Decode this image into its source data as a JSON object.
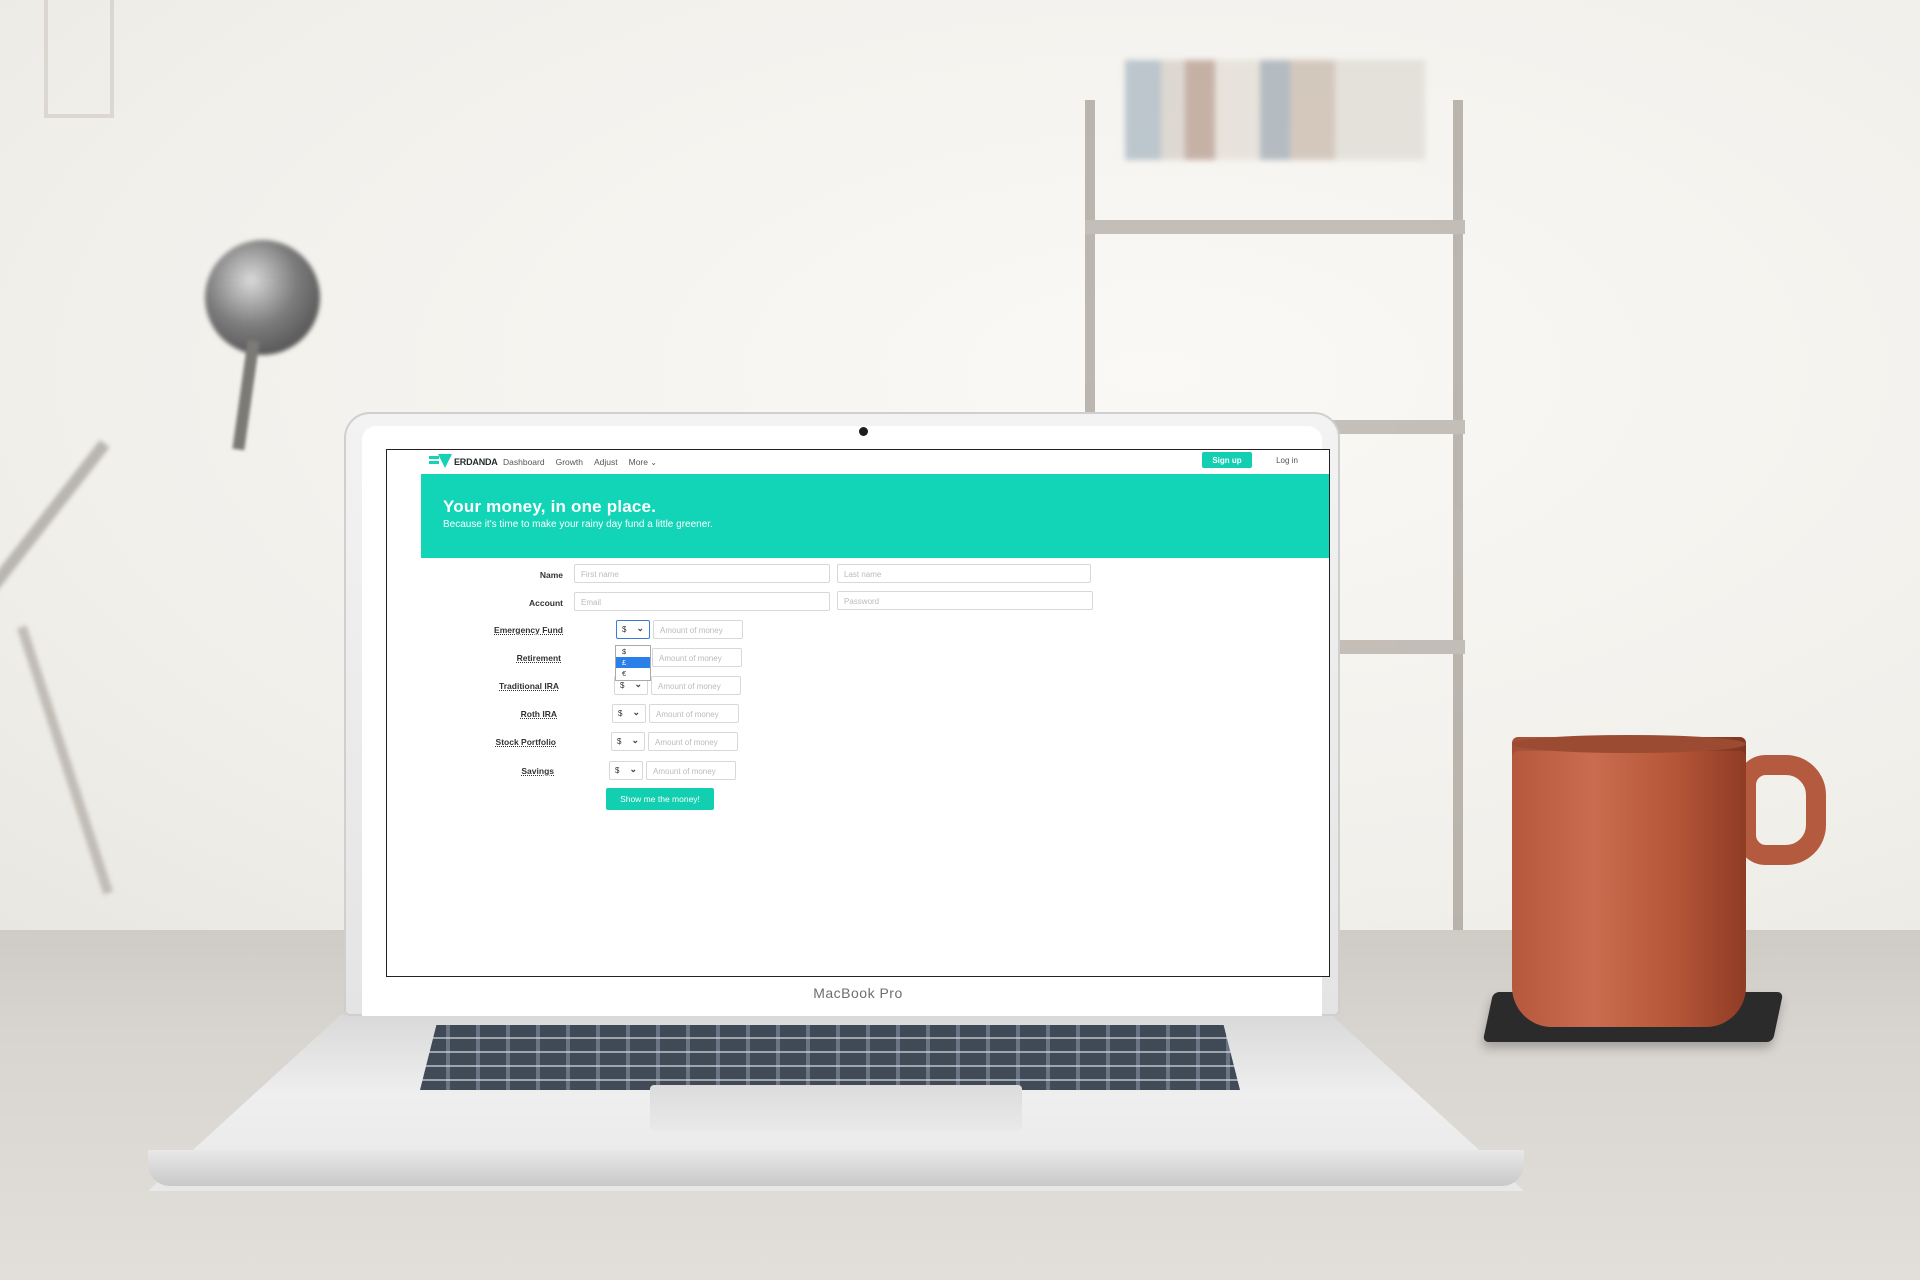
{
  "device_brand": "MacBook Pro",
  "navbar": {
    "logo_text": "ERDANDA",
    "links": [
      "Dashboard",
      "Growth",
      "Adjust",
      "More"
    ],
    "signup_label": "Sign up",
    "login_label": "Log in"
  },
  "hero": {
    "title": "Your money, in one place.",
    "subtitle": "Because it's time to make your rainy day fund a little greener."
  },
  "form": {
    "name_label": "Name",
    "first_name_placeholder": "First name",
    "last_name_placeholder": "Last name",
    "account_label": "Account",
    "email_placeholder": "Email",
    "password_placeholder": "Password",
    "amount_placeholder": "Amount of money",
    "funds": [
      {
        "label": "Emergency Fund",
        "currency": "$"
      },
      {
        "label": "Retirement",
        "currency": "$"
      },
      {
        "label": "Traditional IRA",
        "currency": "$"
      },
      {
        "label": "Roth IRA",
        "currency": "$"
      },
      {
        "label": "Stock Portfolio",
        "currency": "$"
      },
      {
        "label": "Savings",
        "currency": "$"
      }
    ],
    "currency_options": [
      "$",
      "£",
      "€"
    ],
    "selected_option": "£",
    "submit_label": "Show me the money!"
  },
  "colors": {
    "accent": "#12d4b7",
    "focus": "#3a7bd5",
    "mug": "#b6583d"
  }
}
